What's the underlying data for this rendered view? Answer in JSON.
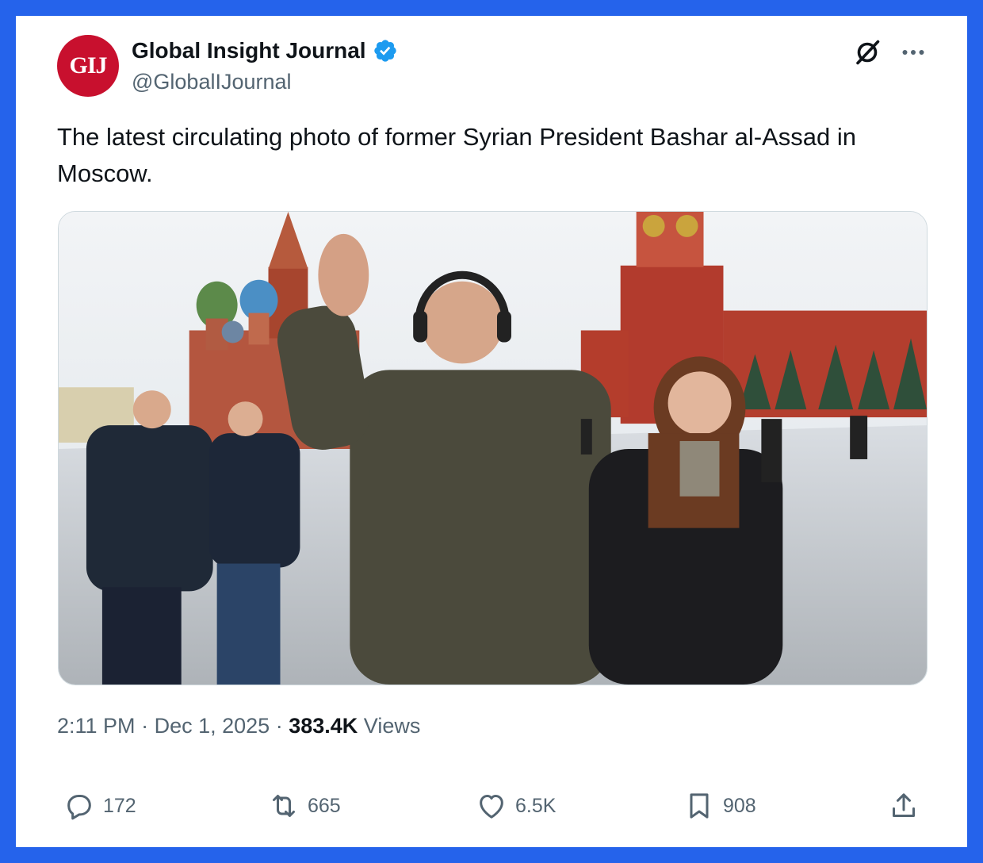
{
  "account": {
    "avatar_text": "GIJ",
    "display_name": "Global Insight Journal",
    "handle": "@GlobalIJournal",
    "verified": true
  },
  "post": {
    "text": "The latest circulating photo of former Syrian President Bashar al-Assad in Moscow.",
    "time": "2:11 PM",
    "date": "Dec 1, 2025",
    "views_count": "383.4K",
    "views_label": "Views"
  },
  "engagement": {
    "replies": "172",
    "reposts": "665",
    "likes": "6.5K",
    "bookmarks": "908"
  },
  "icons": {
    "verified": "verified-badge-icon",
    "grok": "grok-icon",
    "more": "more-icon",
    "reply": "reply-icon",
    "repost": "repost-icon",
    "like": "heart-icon",
    "bookmark": "bookmark-icon",
    "share": "share-icon"
  },
  "colors": {
    "frame": "#2563eb",
    "verified": "#1d9bf0",
    "secondary_text": "#536471",
    "avatar_bg": "#c8102e"
  }
}
